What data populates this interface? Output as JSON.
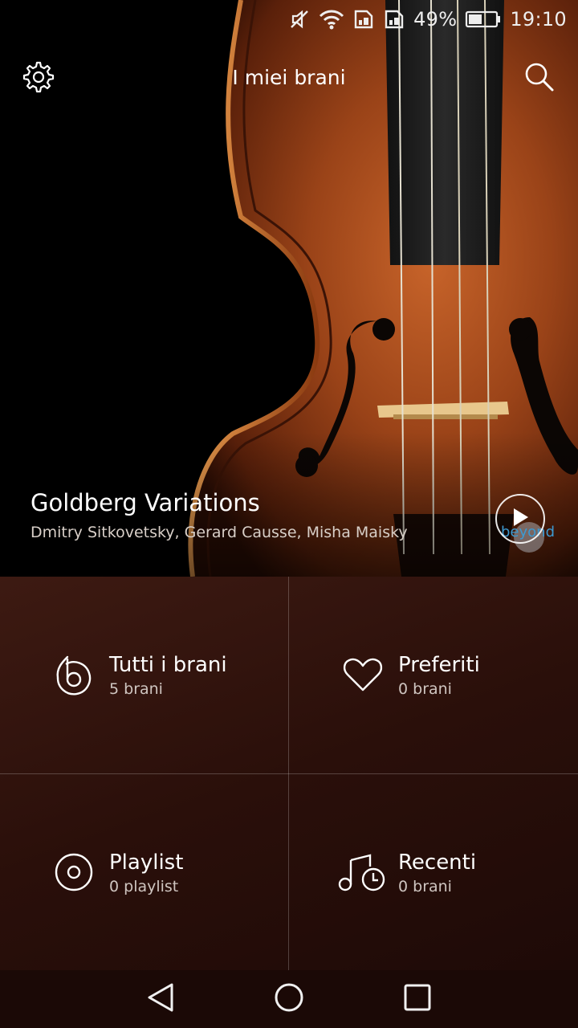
{
  "status_bar": {
    "battery_percent": "49%",
    "time": "19:10",
    "icons": [
      "mute-icon",
      "wifi-icon",
      "sim1-icon",
      "sim2-icon",
      "battery-icon"
    ],
    "battery_level": 0.49
  },
  "header": {
    "title": "I miei brani",
    "left_icon": "gear-icon",
    "right_icon": "search-icon"
  },
  "now_playing": {
    "title": "Goldberg Variations",
    "artist": "Dmitry Sitkovetsky, Gerard Causse, Misha Maisky",
    "play_icon": "play-icon",
    "watermark": "beyond"
  },
  "grid": {
    "tiles": [
      {
        "label": "Tutti i brani",
        "count": "5 brani",
        "icon": "all-songs-icon"
      },
      {
        "label": "Preferiti",
        "count": "0 brani",
        "icon": "heart-icon"
      },
      {
        "label": "Playlist",
        "count": "0 playlist",
        "icon": "disc-icon"
      },
      {
        "label": "Recenti",
        "count": "0 brani",
        "icon": "recent-music-icon"
      }
    ]
  },
  "nav_bar": {
    "icons": [
      "back-icon",
      "home-icon",
      "recents-icon"
    ]
  },
  "colors": {
    "grid_bg": "#2a0f0a",
    "accent_wood": "#8a3a14",
    "text_secondary": "#cfc5c0"
  }
}
